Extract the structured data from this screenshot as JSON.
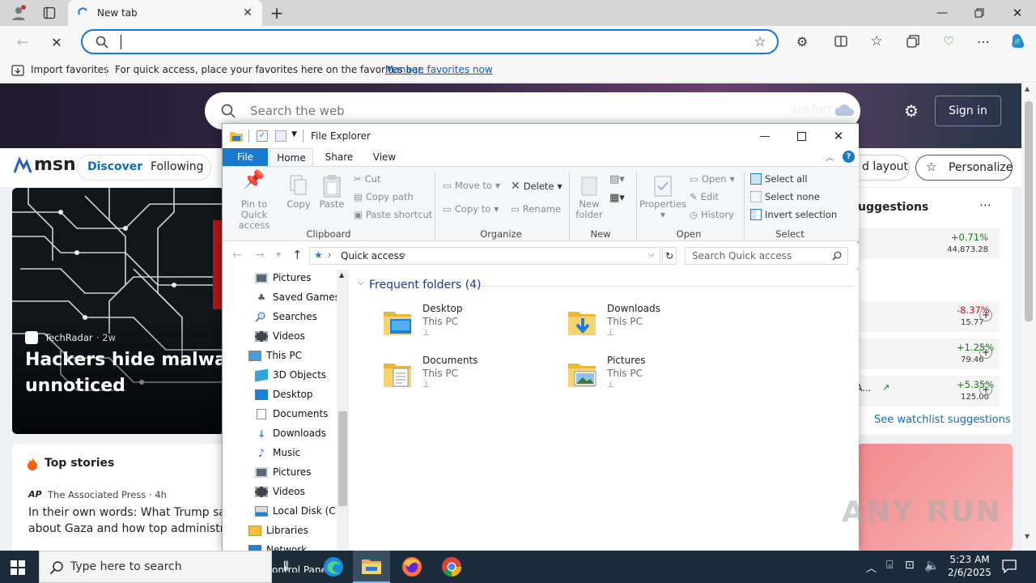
{
  "browser": {
    "tab_title": "New tab",
    "address_value": "",
    "favbar": {
      "import_label": "Import favorites",
      "message": "For quick access, place your favorites here on the favorites bar.",
      "manage_link": "Manage favorites now"
    }
  },
  "msn": {
    "search_placeholder": "Search the web",
    "weather_city_fragment": "ankfurt",
    "sign_in": "Sign in",
    "logo": "msn",
    "nav": [
      "Discover",
      "Following"
    ],
    "layout_btn": "d layout",
    "personalize_btn": "Personalize",
    "hero_source": "TechRadar",
    "hero_age": "· 2w",
    "hero_headline_1": "Hackers hide malware",
    "hero_headline_2": "unnoticed",
    "top_stories_title": "Top stories",
    "story_source": "The Associated Press · 4h",
    "story_headline_1": "In their own words: What Trump said",
    "story_headline_2": "about Gaza and how top administratic",
    "watchlist_title": "uggestions",
    "watchlist": [
      {
        "name": "",
        "change": "+0.71%",
        "price": "44,873.28",
        "color": "#107c10"
      },
      {
        "name": "",
        "change": "-8.37%",
        "price": "15.77",
        "color": "#c50f1f"
      },
      {
        "name": ".",
        "change": "+1.25%",
        "price": "79.46",
        "color": "#107c10"
      },
      {
        "name": "RA...",
        "change": "+5.35%",
        "price": "125.00",
        "color": "#107c10"
      }
    ],
    "see_watchlist": "See watchlist suggestions"
  },
  "explorer": {
    "title": "File Explorer",
    "tabs": [
      "File",
      "Home",
      "Share",
      "View"
    ],
    "ribbon": {
      "pin": [
        "Pin to Quick",
        "access"
      ],
      "copy": "Copy",
      "paste": "Paste",
      "cut": "Cut",
      "copy_path": "Copy path",
      "paste_shortcut": "Paste shortcut",
      "clipboard": "Clipboard",
      "move_to": "Move to",
      "copy_to": "Copy to",
      "delete": "Delete",
      "rename": "Rename",
      "organize": "Organize",
      "new_folder": [
        "New",
        "folder"
      ],
      "new": "New",
      "properties": "Properties",
      "open": "Open",
      "edit": "Edit",
      "history": "History",
      "open_group": "Open",
      "select_all": "Select all",
      "select_none": "Select none",
      "invert_selection": "Invert selection",
      "select_group": "Select"
    },
    "breadcrumb": "Quick access",
    "search_placeholder": "Search Quick access",
    "tree": [
      {
        "label": "Pictures",
        "icon": "pictures-icon"
      },
      {
        "label": "Saved Games",
        "icon": "saved-games-icon"
      },
      {
        "label": "Searches",
        "icon": "searches-icon"
      },
      {
        "label": "Videos",
        "icon": "videos-icon"
      },
      {
        "label": "This PC",
        "icon": "this-pc-icon"
      },
      {
        "label": "3D Objects",
        "icon": "3d-objects-icon"
      },
      {
        "label": "Desktop",
        "icon": "desktop-icon"
      },
      {
        "label": "Documents",
        "icon": "documents-icon"
      },
      {
        "label": "Downloads",
        "icon": "downloads-icon"
      },
      {
        "label": "Music",
        "icon": "music-icon"
      },
      {
        "label": "Pictures",
        "icon": "pictures-icon"
      },
      {
        "label": "Videos",
        "icon": "videos-icon"
      },
      {
        "label": "Local Disk (C:)",
        "icon": "disk-icon"
      },
      {
        "label": "Libraries",
        "icon": "libraries-icon"
      },
      {
        "label": "Network",
        "icon": "network-icon"
      }
    ],
    "section_title": "Frequent folders (4)",
    "folders": [
      {
        "name": "Desktop",
        "location": "This PC"
      },
      {
        "name": "Downloads",
        "location": "This PC"
      },
      {
        "name": "Documents",
        "location": "This PC"
      },
      {
        "name": "Pictures",
        "location": "This PC"
      }
    ]
  },
  "taskbar": {
    "search_placeholder": "Type here to search",
    "time": "5:23 AM",
    "date": "2/6/2025",
    "partial_label": "ontrol Panel"
  },
  "watermark": "ANY RUN"
}
